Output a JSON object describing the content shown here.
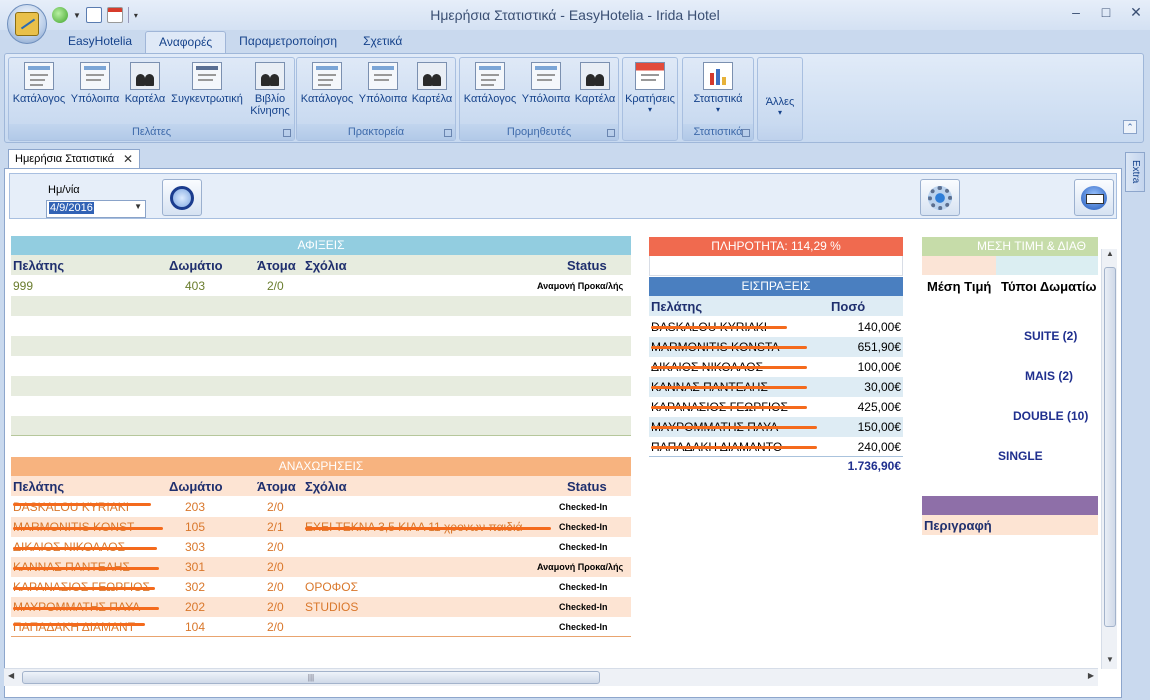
{
  "window": {
    "title": "Ημερήσια Στατιστικά - EasyHotelia - Irida Hotel"
  },
  "ribbon": {
    "tabs": [
      "EasyHotelia",
      "Αναφορές",
      "Παραμετροποίηση",
      "Σχετικά"
    ],
    "active_tab": "Αναφορές",
    "groups": {
      "clients": {
        "label": "Πελάτες",
        "buttons": [
          "Κατάλογος",
          "Υπόλοιπα",
          "Καρτέλα",
          "Συγκεντρωτική",
          "Βιβλίο Κίνησης"
        ]
      },
      "agencies": {
        "label": "Πρακτορεία",
        "buttons": [
          "Κατάλογος",
          "Υπόλοιπα",
          "Καρτέλα"
        ]
      },
      "suppliers": {
        "label": "Προμηθευτές",
        "buttons": [
          "Κατάλογος",
          "Υπόλοιπα",
          "Καρτέλα"
        ]
      },
      "reservations": {
        "button": "Κρατήσεις"
      },
      "statistics": {
        "label": "Στατιστικά",
        "button": "Στατιστικά"
      },
      "others": {
        "button": "Άλλες"
      }
    }
  },
  "doc_tab": {
    "label": "Ημερήσια Στατιστικά"
  },
  "side_tab": "Extra",
  "filter": {
    "date_label": "Ημ/νία",
    "date_value": "4/9/2016"
  },
  "arrivals": {
    "header": "ΑΦΙΞΕΙΣ",
    "columns": [
      "Πελάτης",
      "Δωμάτιο",
      "Άτομα",
      "Σχόλια",
      "Status"
    ],
    "rows": [
      {
        "client": "999",
        "room": "403",
        "people": "2/0",
        "comments": "",
        "status": "Αναμονή Προκα/λής"
      }
    ]
  },
  "departures": {
    "header": "ΑΝΑΧΩΡΗΣΕΙΣ",
    "columns": [
      "Πελάτης",
      "Δωμάτιο",
      "Άτομα",
      "Σχόλια",
      "Status"
    ],
    "rows": [
      {
        "client": "DASKALOU KYRIAKI",
        "room": "203",
        "people": "2/0",
        "comments": "",
        "status": "Checked-In"
      },
      {
        "client": "MARMONITIS KONST",
        "room": "105",
        "people": "2/1",
        "comments": "ΕΧΕΙ ΤΕΚΝΑ 3,5 ΚΙΛΑ 11 χρονων παιδιά",
        "status": "Checked-In"
      },
      {
        "client": "ΔΙΚΑΙΟΣ ΝΙΚΟΛΑΟΣ",
        "room": "303",
        "people": "2/0",
        "comments": "",
        "status": "Checked-In"
      },
      {
        "client": "ΚΑΝΝΑΣ ΠΑΝΤΕΛΗΣ",
        "room": "301",
        "people": "2/0",
        "comments": "",
        "status": "Αναμονή Προκα/λής"
      },
      {
        "client": "ΚΑΡΑΝΑΣΙΟΣ ΓΕΩΡΓΙΟΣ",
        "room": "302",
        "people": "2/0",
        "comments": "ΟΡΟΦΟΣ",
        "status": "Checked-In"
      },
      {
        "client": "ΜΑΥΡΟΜΜΑΤΗΣ ΠΑΥΛ",
        "room": "202",
        "people": "2/0",
        "comments": "STUDIOS",
        "status": "Checked-In"
      },
      {
        "client": "ΠΑΠΑΔΑΚΗ ΔΙΑΜΑΝΤ",
        "room": "104",
        "people": "2/0",
        "comments": "",
        "status": "Checked-In"
      }
    ]
  },
  "occupancy": {
    "label": "ΠΛΗΡΟΤΗΤΑ: 114,29 %"
  },
  "receipts": {
    "header": "ΕΙΣΠΡΑΞΕΙΣ",
    "columns": [
      "Πελάτης",
      "Ποσό"
    ],
    "rows": [
      {
        "client": "DASKALOU KYRIAKI",
        "amount": "140,00€"
      },
      {
        "client": "MARMONITIS KONSTA",
        "amount": "651,90€"
      },
      {
        "client": "ΔΙΚΑΙΟΣ ΝΙΚΟΛΑΟΣ",
        "amount": "100,00€"
      },
      {
        "client": "ΚΑΝΝΑΣ ΠΑΝΤΕΛΗΣ",
        "amount": "30,00€"
      },
      {
        "client": "ΚΑΡΑΝΑΣΙΟΣ ΓΕΩΡΓΙΟΣ",
        "amount": "425,00€"
      },
      {
        "client": "ΜΑΥΡΟΜΜΑΤΗΣ ΠΑΥΛ",
        "amount": "150,00€"
      },
      {
        "client": "ΠΑΠΑΔΑΚΗ ΔΙΑΜΑΝΤΟ",
        "amount": "240,00€"
      }
    ],
    "total": "1.736,90€"
  },
  "avg_price": {
    "header": "ΜΕΣΗ ΤΙΜΗ & ΔΙΑΘ",
    "col_price": "Μέση Τιμή",
    "col_types": "Τύποι Δωματίω",
    "types": [
      "SUITE (2)",
      "MAIS (2)",
      "DOUBLE (10)",
      "SINGLE"
    ],
    "desc_label": "Περιγραφή"
  },
  "colors": {
    "arrivals_header": "#92cde0",
    "departures_header": "#f7b37f",
    "occupancy_header": "#f06a4f",
    "receipts_header": "#4a7fc0",
    "avg_header": "#c6dca9",
    "desc_header": "#8e6fa8",
    "strike": "#f46a1c"
  }
}
